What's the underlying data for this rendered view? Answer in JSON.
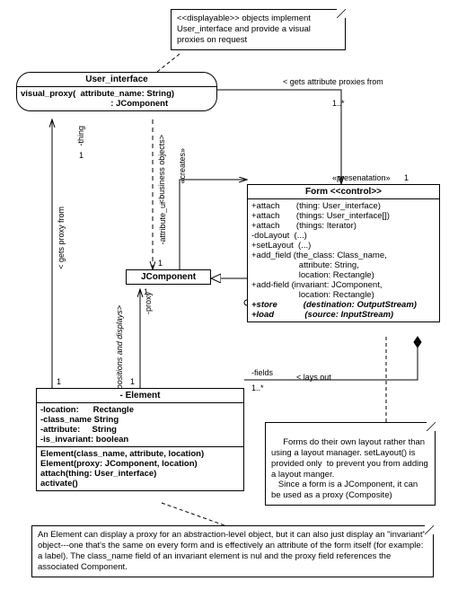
{
  "notes": {
    "displayable": "<<displayable>> objects implement User_interface and provide a visual proxies on request",
    "forms": "   Forms do their own layout rather than using a layout manager. setLayout() is provided only  to prevent you from adding a layout manger.\n   Since a form is a JComponent, it can be used as a proxy (Composite)",
    "element": "An Element can display a proxy for an abstraction-level object, but it can also just display an \"invariant\" object---one that's the same on every form and is effectively an attribute of the form itself (for example: a label). The  class_name field of an invariant element is nul and  the proxy field references the associated Component."
  },
  "classes": {
    "user_interface": {
      "name": "User_interface",
      "op": "visual_proxy(  attribute_name: String)\n                                      : JComponent"
    },
    "jcomponent": {
      "name": "JComponent"
    },
    "form": {
      "stereo": "«presenatation»",
      "mult": "1",
      "name": "Form <<control>>",
      "ops": [
        "+attach       (thing: User_interface)",
        "+attach       (things: User_interface[])",
        "+attach       (things: Iterator)",
        "-doLayout  (...)",
        "+setLayout  (...)",
        "+add_field (the_class: Class_name,",
        "                    attribute: String,",
        "                    location: Rectangle)",
        "+add-field (invariant: JComponent,",
        "                    location: Rectangle)",
        "+store           (destination: OutputStream)",
        "+load             (source: InputStream)"
      ]
    },
    "element": {
      "name": "- Element",
      "attrs": [
        "-location:      Rectangle",
        "-class_name String",
        "-attribute:     String",
        "-is_invariant: boolean"
      ],
      "ops": [
        "Element(class_name, attribute, location)",
        "Element(proxy: JComponent, location)",
        "attach(thing: User_interface)",
        "activate()"
      ]
    }
  },
  "labels": {
    "gets_attr": "< gets attribute proxies from",
    "mult_1star": "1..*",
    "one": "1",
    "business": "<business objects>",
    "creates": "«creates»",
    "attribute_ui": "-attribute_ui",
    "thing": "-thing",
    "gets_proxy": "< gets proxy from",
    "proxy": "-proxy",
    "positions": "positions and displays>",
    "fields": "-fields",
    "lays_out": "< lays out",
    "mult_1star2": "1..*"
  },
  "chart_data": {
    "type": "uml_class_diagram",
    "classes": [
      {
        "name": "User_interface",
        "kind": "interface",
        "operations": [
          "visual_proxy(attribute_name: String): JComponent"
        ]
      },
      {
        "name": "JComponent",
        "kind": "class"
      },
      {
        "name": "Form",
        "stereotype": "<<control>>",
        "package_stereotype": "«presenatation»",
        "operations": [
          "+attach(thing: User_interface)",
          "+attach(things: User_interface[])",
          "+attach(things: Iterator)",
          "-doLayout(...)",
          "+setLayout(...)",
          "+add_field(the_class: Class_name, attribute: String, location: Rectangle)",
          "+add-field(invariant: JComponent, location: Rectangle)",
          "+store(destination: OutputStream)",
          "+load(source: InputStream)"
        ]
      },
      {
        "name": "Element",
        "visibility": "-",
        "attributes": [
          "-location: Rectangle",
          "-class_name: String",
          "-attribute: String",
          "-is_invariant: boolean"
        ],
        "operations": [
          "Element(class_name, attribute, location)",
          "Element(proxy: JComponent, location)",
          "attach(thing: User_interface)",
          "activate()"
        ]
      }
    ],
    "relationships": [
      {
        "from": "Form",
        "to": "User_interface",
        "type": "association",
        "label": "gets attribute proxies from",
        "from_mult": "1",
        "to_mult": "1..*"
      },
      {
        "from": "Form",
        "to": "JComponent",
        "type": "generalization"
      },
      {
        "from": "Form",
        "to": "Element",
        "type": "composition",
        "role": "-fields",
        "label": "lays out",
        "to_mult": "1..*"
      },
      {
        "from": "Element",
        "to": "JComponent",
        "type": "association",
        "role": "-proxy",
        "label": "positions and displays",
        "from_mult": "1",
        "to_mult": "1"
      },
      {
        "from": "Element",
        "to": "User_interface",
        "type": "association",
        "role": "-thing",
        "label": "gets proxy from",
        "from_mult": "1",
        "to_mult": "1"
      },
      {
        "from": "User_interface",
        "to": "JComponent",
        "type": "dependency",
        "stereotype": "«creates»"
      },
      {
        "from": "JComponent",
        "to": "Form",
        "type": "association",
        "role": "-attribute_ui",
        "label": "business objects",
        "from_mult": "1"
      }
    ],
    "notes": [
      {
        "text": "<<displayable>> objects implement User_interface and provide a visual proxies on request",
        "attached_to": "User_interface"
      },
      {
        "text": "Forms do their own layout rather than using a layout manager. setLayout() is provided only to prevent you from adding a layout manger. Since a form is a JComponent, it can be used as a proxy (Composite)",
        "attached_to": "Form"
      },
      {
        "text": "An Element can display a proxy for an abstraction-level object, but it can also just display an \"invariant\" object---one that's the same on every form and is effectively an attribute of the form itself (for example: a label). The class_name field of an invariant element is nul and the proxy field references the associated Component.",
        "attached_to": "Element"
      }
    ]
  }
}
